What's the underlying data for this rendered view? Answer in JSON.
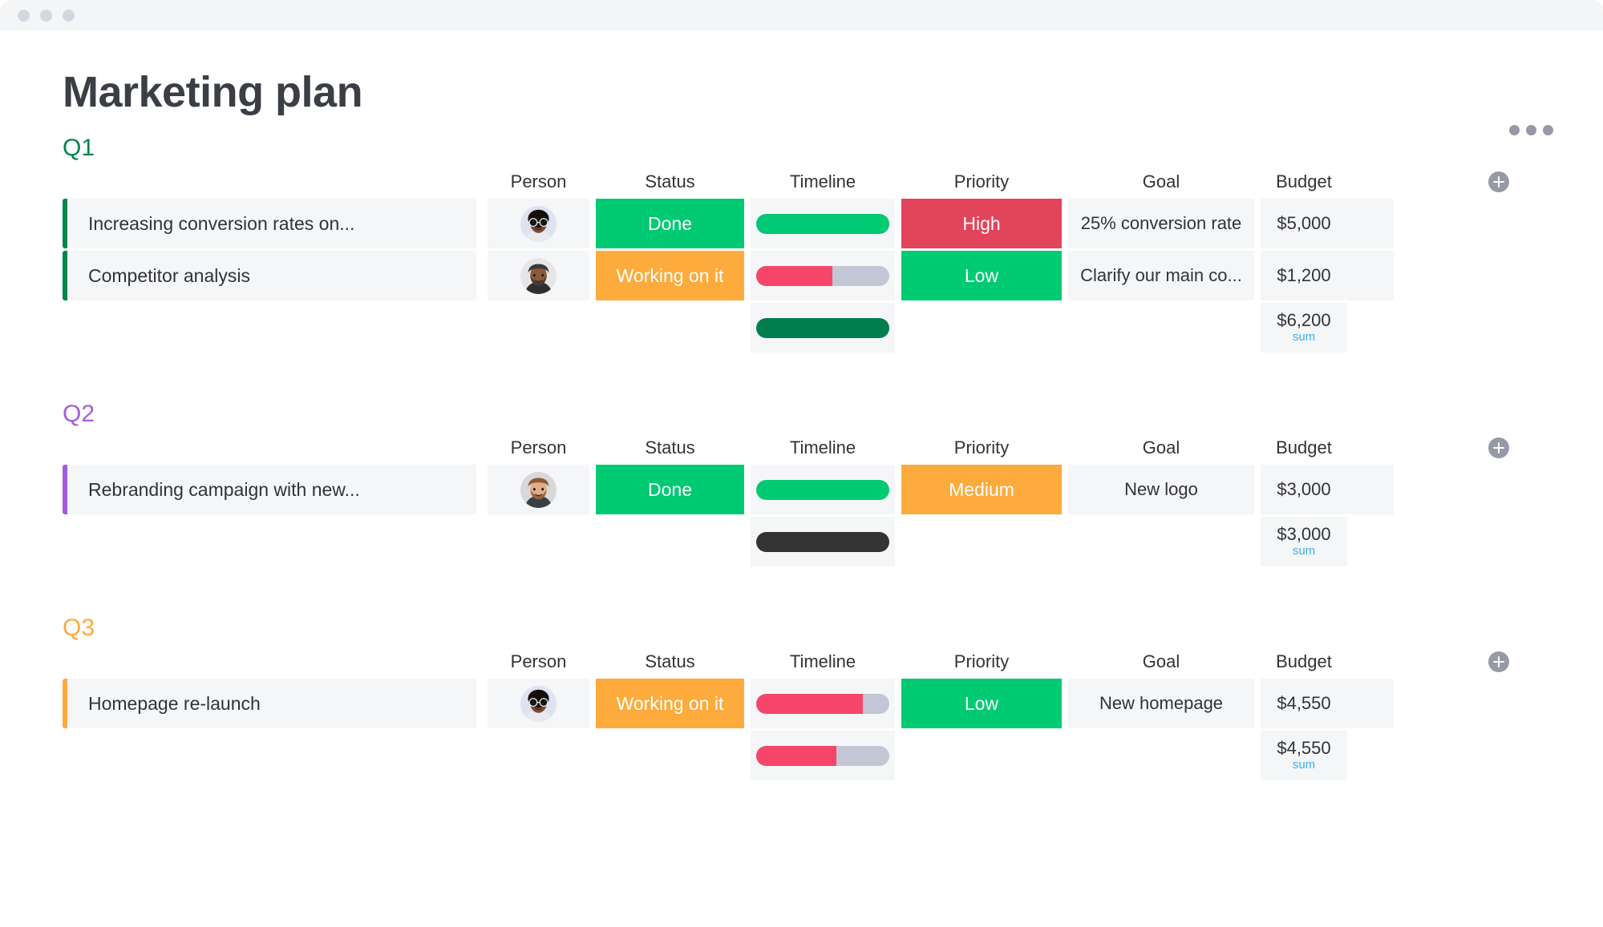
{
  "window": {
    "traffic_lights": [
      "dot-1",
      "dot-2",
      "dot-3"
    ],
    "more_menu_icon": "more-horizontal-icon"
  },
  "board": {
    "title": "Marketing plan",
    "add_column_icon": "plus-circle-icon"
  },
  "columns": [
    "Person",
    "Status",
    "Timeline",
    "Priority",
    "Goal",
    "Budget"
  ],
  "colors": {
    "q1_accent": "#00854d",
    "q2_accent": "#a25ddc",
    "q3_accent": "#fdab3d",
    "status_done": "#00ca72",
    "status_working": "#fdab3d",
    "priority_high": "#e2445c",
    "priority_medium": "#fdab3d",
    "priority_low": "#00ca72",
    "timeline_green": "#00c875",
    "timeline_green_light": "#00ca72",
    "timeline_dark_green": "#007e4e",
    "timeline_red": "#f6476a",
    "timeline_dark": "#333333",
    "timeline_track": "#c3c6d4",
    "sum_label": "#39b0f5",
    "cell_bg": "#f5f6f8",
    "text": "#323338"
  },
  "groups": [
    {
      "title": "Q1",
      "accent": "#00854d",
      "items": [
        {
          "name": "Increasing conversion rates on...",
          "person": "avatar-woman-glasses",
          "status": "Done",
          "status_color": "#00ca72",
          "timeline_pct": 100,
          "timeline_split_pct": 80,
          "timeline_color": "#00c875",
          "timeline_color2": "#00ca72",
          "priority": "High",
          "priority_color": "#e2445c",
          "goal": "25% conversion rate",
          "budget": "$5,000"
        },
        {
          "name": "Competitor analysis",
          "person": "avatar-man-beard",
          "status": "Working on it",
          "status_color": "#fdab3d",
          "timeline_pct": 57,
          "timeline_split_pct": 57,
          "timeline_color": "#f6476a",
          "timeline_color2": "#f6476a",
          "priority": "Low",
          "priority_color": "#00ca72",
          "goal": "Clarify our main co...",
          "budget": "$1,200"
        }
      ],
      "summary": {
        "timeline_pct": 100,
        "timeline_color": "#007e4e",
        "budget": "$6,200",
        "budget_label": "sum"
      }
    },
    {
      "title": "Q2",
      "accent": "#a25ddc",
      "items": [
        {
          "name": "Rebranding campaign with new...",
          "person": "avatar-man-short-hair",
          "status": "Done",
          "status_color": "#00ca72",
          "timeline_pct": 100,
          "timeline_split_pct": 100,
          "timeline_color": "#00ca72",
          "timeline_color2": "#00ca72",
          "priority": "Medium",
          "priority_color": "#fdab3d",
          "goal": "New logo",
          "budget": "$3,000"
        }
      ],
      "summary": {
        "timeline_pct": 100,
        "timeline_color": "#333333",
        "budget": "$3,000",
        "budget_label": "sum"
      }
    },
    {
      "title": "Q3",
      "accent": "#fdab3d",
      "items": [
        {
          "name": "Homepage re-launch",
          "person": "avatar-woman-glasses",
          "status": "Working on it",
          "status_color": "#fdab3d",
          "timeline_pct": 80,
          "timeline_split_pct": 80,
          "timeline_color": "#f6476a",
          "timeline_color2": "#f6476a",
          "priority": "Low",
          "priority_color": "#00ca72",
          "goal": "New homepage",
          "budget": "$4,550"
        }
      ],
      "summary": {
        "timeline_pct": 60,
        "timeline_color": "#f6476a",
        "budget": "$4,550",
        "budget_label": "sum"
      }
    }
  ]
}
